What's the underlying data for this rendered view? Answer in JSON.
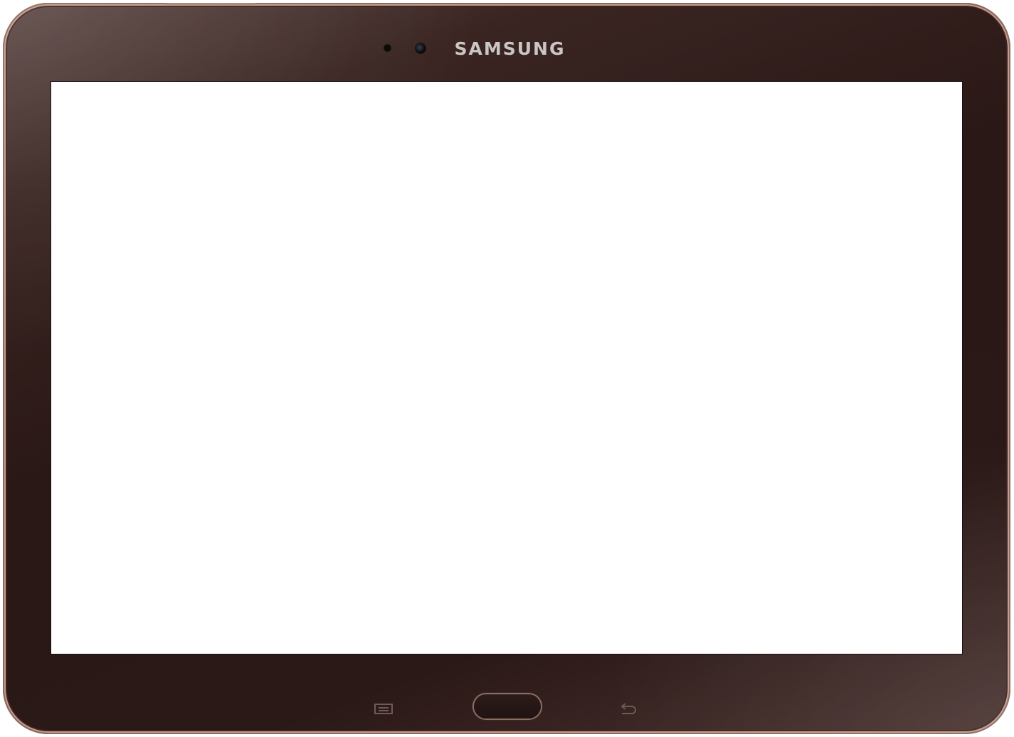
{
  "device": {
    "brand_label": "SAMSUNG",
    "body_color": "#2a1816",
    "screen_color": "#ffffff",
    "brand_text_color": "#c9c6c4"
  },
  "hardware_keys": {
    "menu_icon": "menu-icon",
    "home_icon": "home-button",
    "back_icon": "back-icon"
  }
}
